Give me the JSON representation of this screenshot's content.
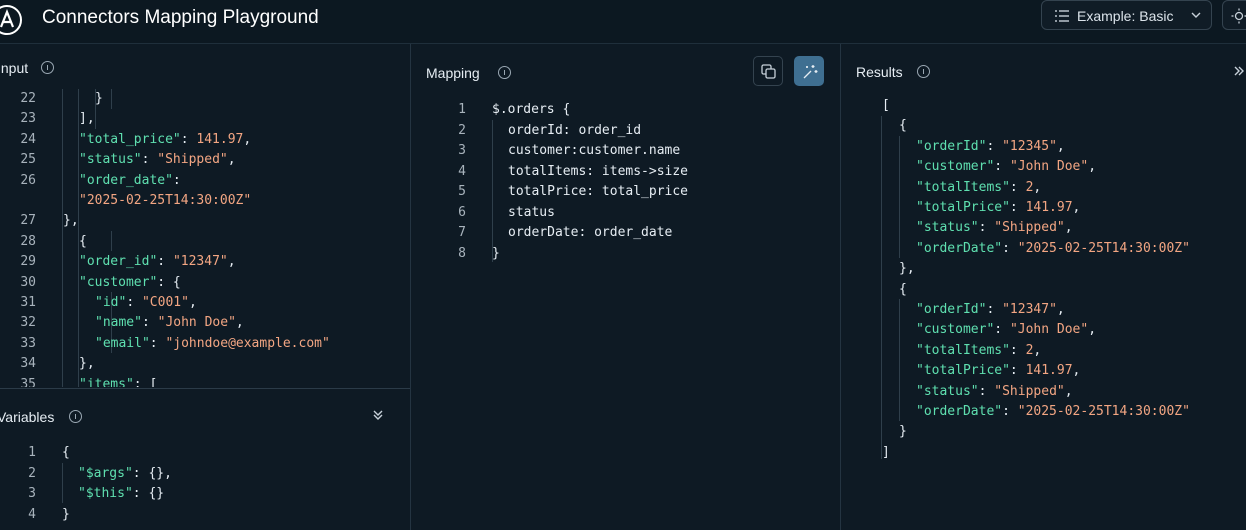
{
  "app": {
    "title": "Connectors Mapping Playground"
  },
  "example_select": {
    "value": "Example:  Basic"
  },
  "input_panel": {
    "title": "Input",
    "lines": [
      {
        "n": "22",
        "t": "}"
      },
      {
        "n": "23",
        "t": "],"
      },
      {
        "n": "24",
        "t": "\"total_price\": 141.97,"
      },
      {
        "n": "25",
        "t": "\"status\": \"Shipped\","
      },
      {
        "n": "26",
        "t": "\"order_date\":"
      },
      {
        "n": "",
        "t": "\"2025-02-25T14:30:00Z\""
      },
      {
        "n": "27",
        "t": "},"
      },
      {
        "n": "28",
        "t": "{"
      },
      {
        "n": "29",
        "t": "\"order_id\": \"12347\","
      },
      {
        "n": "30",
        "t": "\"customer\": {"
      },
      {
        "n": "31",
        "t": "\"id\": \"C001\","
      },
      {
        "n": "32",
        "t": "\"name\": \"John Doe\","
      },
      {
        "n": "33",
        "t": "\"email\": \"johndoe@example.com\""
      },
      {
        "n": "34",
        "t": "},"
      },
      {
        "n": "35",
        "t": "\"items\": ["
      }
    ]
  },
  "variables_panel": {
    "title": "Variables",
    "lines": [
      {
        "n": "1",
        "t": "{"
      },
      {
        "n": "2",
        "t": "\"$args\": {},"
      },
      {
        "n": "3",
        "t": "\"$this\": {}"
      },
      {
        "n": "4",
        "t": "}"
      }
    ]
  },
  "mapping_panel": {
    "title": "Mapping",
    "lines": [
      {
        "n": "1",
        "t": "$.orders {"
      },
      {
        "n": "2",
        "t": "orderId: order_id"
      },
      {
        "n": "3",
        "t": "customer:customer.name"
      },
      {
        "n": "4",
        "t": "totalItems: items->size"
      },
      {
        "n": "5",
        "t": "totalPrice: total_price"
      },
      {
        "n": "6",
        "t": "status"
      },
      {
        "n": "7",
        "t": "orderDate: order_date"
      },
      {
        "n": "8",
        "t": "}"
      }
    ]
  },
  "results_panel": {
    "title": "Results",
    "lines": [
      {
        "t": "["
      },
      {
        "t": "{"
      },
      {
        "t": "\"orderId\": \"12345\","
      },
      {
        "t": "\"customer\": \"John Doe\","
      },
      {
        "t": "\"totalItems\": 2,"
      },
      {
        "t": "\"totalPrice\": 141.97,"
      },
      {
        "t": "\"status\": \"Shipped\","
      },
      {
        "t": "\"orderDate\": \"2025-02-25T14:30:00Z\""
      },
      {
        "t": "},"
      },
      {
        "t": "{"
      },
      {
        "t": "\"orderId\": \"12347\","
      },
      {
        "t": "\"customer\": \"John Doe\","
      },
      {
        "t": "\"totalItems\": 2,"
      },
      {
        "t": "\"totalPrice\": 141.97,"
      },
      {
        "t": "\"status\": \"Shipped\","
      },
      {
        "t": "\"orderDate\": \"2025-02-25T14:30:00Z\""
      },
      {
        "t": "}"
      },
      {
        "t": "]"
      }
    ]
  },
  "colors": {
    "key": "#5fe0b0",
    "string": "#f3a683",
    "accent": "#3f6f91",
    "background": "#0e1a24"
  },
  "icons": [
    "apollo-logo-icon",
    "list-icon",
    "chevron-down-icon",
    "sun-icon",
    "info-icon",
    "copy-icon",
    "format-icon",
    "chevrons-down-icon",
    "chevrons-right-icon"
  ]
}
